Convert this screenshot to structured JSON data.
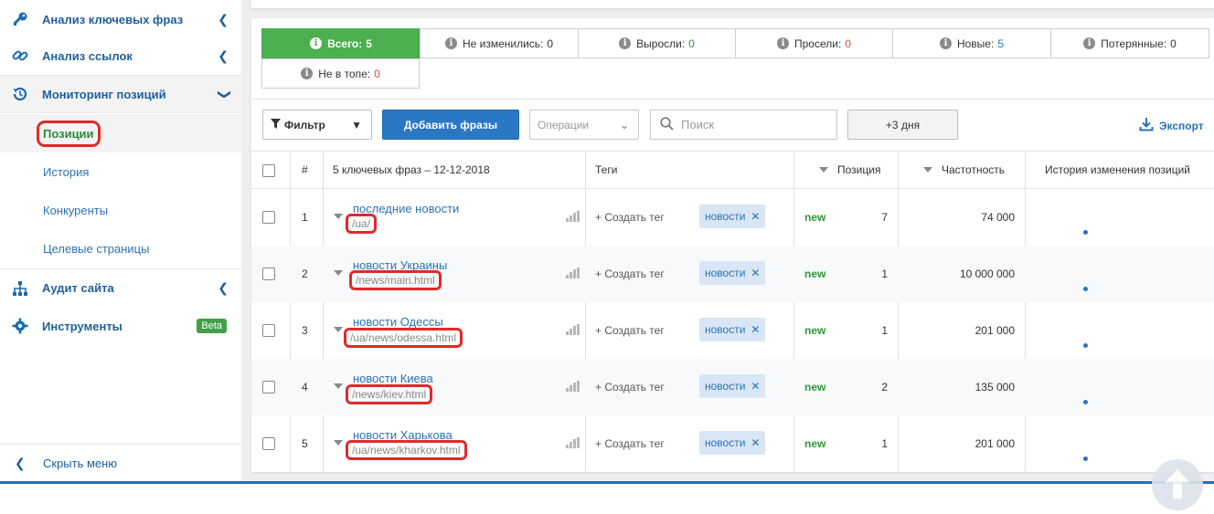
{
  "sidebar": {
    "items": [
      {
        "label": "Анализ ключевых фраз",
        "icon": "key-icon"
      },
      {
        "label": "Анализ ссылок",
        "icon": "link-icon"
      },
      {
        "label": "Мониторинг позиций",
        "icon": "history-icon"
      },
      {
        "label": "Аудит сайта",
        "icon": "sitemap-icon"
      },
      {
        "label": "Инструменты",
        "icon": "gear-icon",
        "badge": "Beta"
      }
    ],
    "sub_items": [
      {
        "label": "Позиции"
      },
      {
        "label": "История"
      },
      {
        "label": "Конкуренты"
      },
      {
        "label": "Целевые страницы"
      }
    ],
    "hide_menu": "Скрыть меню"
  },
  "filter_tabs": [
    {
      "label": "Всего:",
      "count": "5"
    },
    {
      "label": "Не изменились:",
      "count": "0"
    },
    {
      "label": "Выросли:",
      "count": "0"
    },
    {
      "label": "Просели:",
      "count": "0"
    },
    {
      "label": "Новые:",
      "count": "5"
    },
    {
      "label": "Потерянные:",
      "count": "0"
    },
    {
      "label": "Не в топе:",
      "count": "0"
    }
  ],
  "toolbar": {
    "filter_label": "Фильтр",
    "add_phrases": "Добавить фразы",
    "operations_placeholder": "Операции",
    "search_placeholder": "Поиск",
    "days_button": "+3 дня",
    "export_label": "Экспорт"
  },
  "table": {
    "headers": {
      "num": "#",
      "keywords": "5 ключевых фраз – 12-12-2018",
      "tags": "Теги",
      "position": "Позиция",
      "frequency": "Частотность",
      "history": "История изменения позиций"
    },
    "rows": [
      {
        "num": "1",
        "keyword": "последние новости",
        "url": "/ua/",
        "create_tag": "+ Создать тег",
        "tag": "новости",
        "status": "new",
        "position": "7",
        "frequency": "74 000"
      },
      {
        "num": "2",
        "keyword": "новости Украины",
        "url": "/news/main.html",
        "create_tag": "+ Создать тег",
        "tag": "новости",
        "status": "new",
        "position": "1",
        "frequency": "10 000 000"
      },
      {
        "num": "3",
        "keyword": "новости Одессы",
        "url": "/ua/news/odessa.html",
        "create_tag": "+ Создать тег",
        "tag": "новости",
        "status": "new",
        "position": "1",
        "frequency": "201 000"
      },
      {
        "num": "4",
        "keyword": "новости Киева",
        "url": "/news/kiev.html",
        "create_tag": "+ Создать тег",
        "tag": "новости",
        "status": "new",
        "position": "2",
        "frequency": "135 000"
      },
      {
        "num": "5",
        "keyword": "новости Харькова",
        "url": "/ua/news/kharkov.html",
        "create_tag": "+ Создать тег",
        "tag": "новости",
        "status": "new",
        "position": "1",
        "frequency": "201 000"
      }
    ]
  },
  "colors": {
    "accent_blue": "#2a77c5",
    "active_green": "#4caf50",
    "highlight_red": "#e02a2a"
  }
}
